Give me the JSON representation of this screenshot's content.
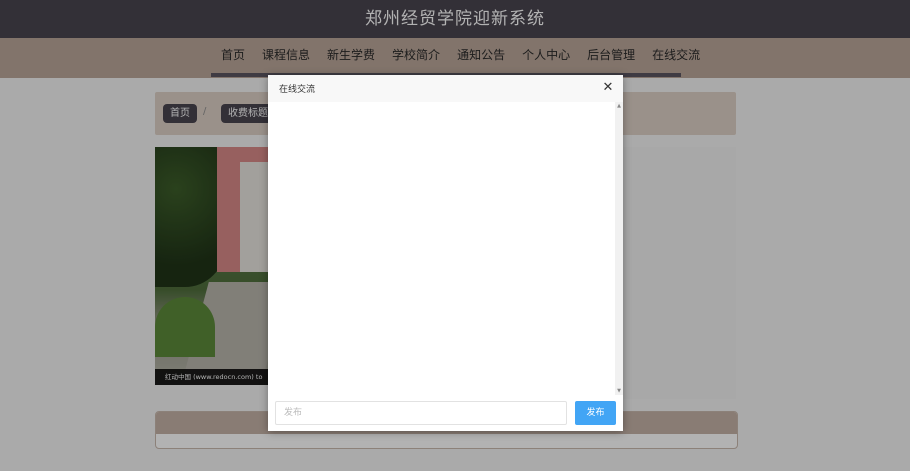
{
  "header": {
    "title": "郑州经贸学院迎新系统"
  },
  "nav": {
    "items": [
      "首页",
      "课程信息",
      "新生学费",
      "学校简介",
      "通知公告",
      "个人中心",
      "后台管理",
      "在线交流"
    ]
  },
  "breadcrumb": {
    "home": "首页",
    "separator": "/",
    "current": "收费标题"
  },
  "photo": {
    "caption": "红动中国 (www.redocn.com)   to"
  },
  "dialog": {
    "title": "在线交流",
    "close_icon": "close-icon",
    "input_placeholder": "发布",
    "send_label": "发布"
  },
  "colors": {
    "header_bg": "#4a4550",
    "nav_bg": "#bba79a",
    "send_button": "#42a5f5"
  }
}
